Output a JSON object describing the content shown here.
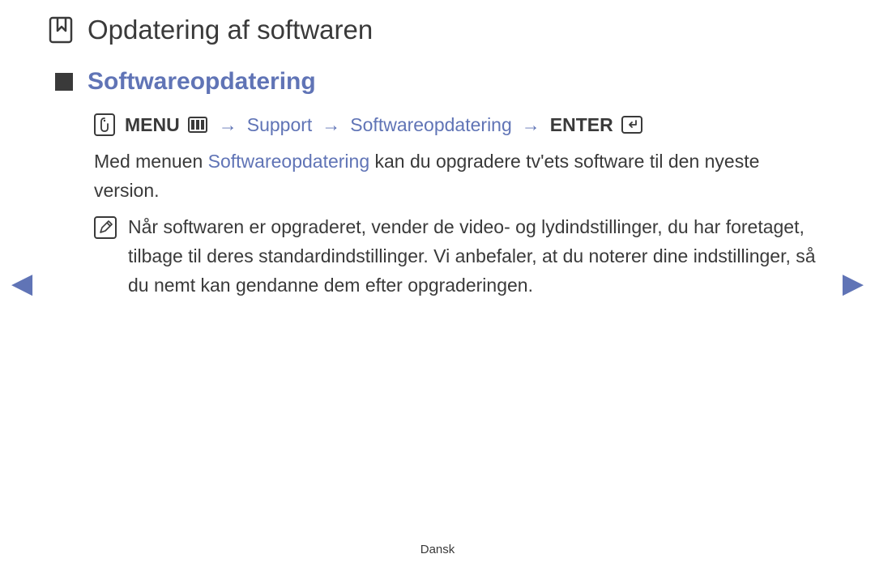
{
  "page": {
    "title": "Opdatering af softwaren"
  },
  "section": {
    "title": "Softwareopdatering"
  },
  "breadcrumb": {
    "menu_label": "MENU",
    "arrow": "→",
    "path1": "Support",
    "path2": "Softwareopdatering",
    "enter_label": "ENTER"
  },
  "body": {
    "p1_prefix": "Med menuen ",
    "p1_highlight": "Softwareopdatering",
    "p1_suffix": " kan du opgradere tv'ets software til den nyeste version."
  },
  "note": {
    "text": "Når softwaren er opgraderet, vender de video- og lydindstillinger, du har foretaget, tilbage til deres standardindstillinger. Vi anbefaler, at du noterer dine indstillinger, så du nemt kan gendanne dem efter opgraderingen."
  },
  "nav": {
    "prev": "◀",
    "next": "▶"
  },
  "footer": {
    "language": "Dansk"
  }
}
